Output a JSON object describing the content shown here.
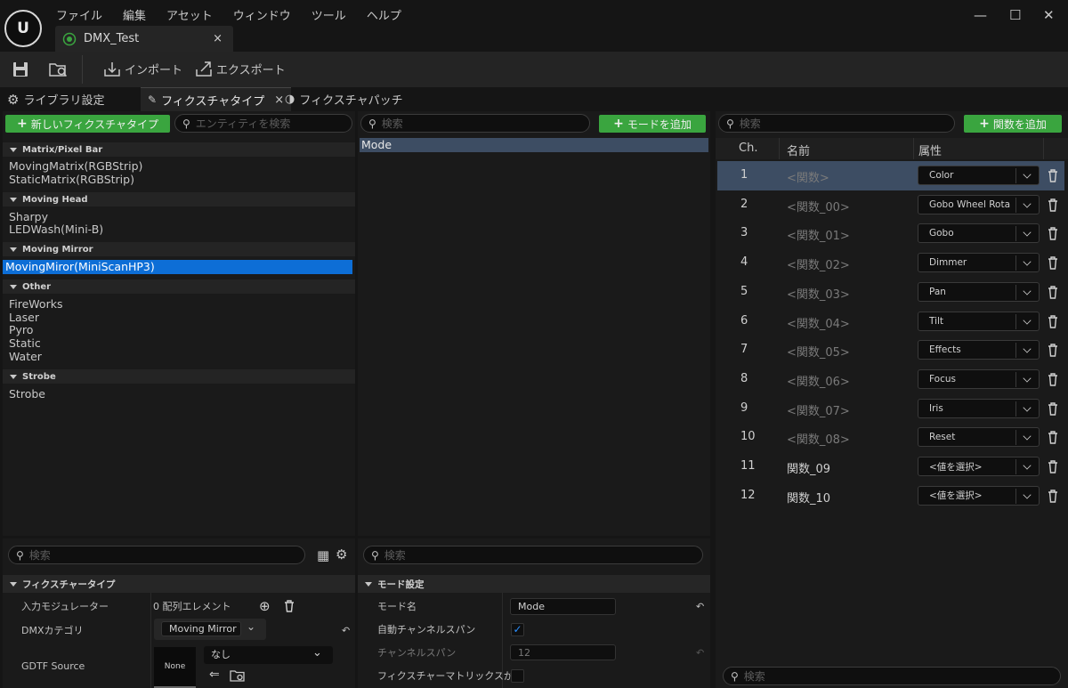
{
  "menu": [
    "ファイル",
    "編集",
    "アセット",
    "ウィンドウ",
    "ツール",
    "ヘルプ"
  ],
  "doc_tab": {
    "title": "DMX_Test",
    "close": "×"
  },
  "window_controls": {
    "minimize": "—",
    "maximize": "☐",
    "close": "✕"
  },
  "toolbar": {
    "import": "インポート",
    "export": "エクスポート"
  },
  "tabs": [
    {
      "label": "ライブラリ設定",
      "icon": "gear-icon"
    },
    {
      "label": "フィクスチャタイプ",
      "icon": "fixture-icon",
      "close": "×"
    },
    {
      "label": "フィクスチャパッチ",
      "icon": "patch-icon"
    }
  ],
  "left": {
    "new_button": "新しいフィクスチャタイプ",
    "search_placeholder": "エンティティを検索",
    "categories": [
      {
        "name": "Matrix/Pixel Bar",
        "items": [
          "MovingMatrix(RGBStrip)",
          "StaticMatrix(RGBStrip)"
        ]
      },
      {
        "name": "Moving Head",
        "items": [
          "Sharpy",
          "LEDWash(Mini-B)"
        ]
      },
      {
        "name": "Moving Mirror",
        "items": [
          "MovingMiror(MiniScanHP3)"
        ]
      },
      {
        "name": "Other",
        "items": [
          "FireWorks",
          "Laser",
          "Pyro",
          "Static",
          "Water"
        ]
      },
      {
        "name": "Strobe",
        "items": [
          "Strobe"
        ]
      }
    ],
    "selected_item": "MovingMiror(MiniScanHP3)"
  },
  "middle": {
    "search_placeholder": "検索",
    "add_mode_button": "モードを追加",
    "modes": [
      "Mode"
    ]
  },
  "right": {
    "search_placeholder": "検索",
    "add_function_button": "関数を追加",
    "headers": {
      "ch": "Ch.",
      "name": "名前",
      "attr": "属性"
    },
    "rows": [
      {
        "ch": "1",
        "name": "<関数>",
        "attr": "Color"
      },
      {
        "ch": "2",
        "name": "<関数_00>",
        "attr": "Gobo Wheel Rota"
      },
      {
        "ch": "3",
        "name": "<関数_01>",
        "attr": "Gobo"
      },
      {
        "ch": "4",
        "name": "<関数_02>",
        "attr": "Dimmer"
      },
      {
        "ch": "5",
        "name": "<関数_03>",
        "attr": "Pan"
      },
      {
        "ch": "6",
        "name": "<関数_04>",
        "attr": "Tilt"
      },
      {
        "ch": "7",
        "name": "<関数_05>",
        "attr": "Effects"
      },
      {
        "ch": "8",
        "name": "<関数_06>",
        "attr": "Focus"
      },
      {
        "ch": "9",
        "name": "<関数_07>",
        "attr": "Iris"
      },
      {
        "ch": "10",
        "name": "<関数_08>",
        "attr": "Reset"
      },
      {
        "ch": "11",
        "name": "関数_09",
        "attr": "<値を選択>"
      },
      {
        "ch": "12",
        "name": "関数_10",
        "attr": "<値を選択>"
      }
    ],
    "bottom_search_placeholder": "検索"
  },
  "details_left": {
    "search_placeholder": "検索",
    "section": "フィクスチャータイプ",
    "input_modulators_label": "入力モジュレーター",
    "input_modulators_value": "0 配列エレメント",
    "dmx_category_label": "DMXカテゴリ",
    "dmx_category_value": "Moving Mirror",
    "gdtf_source_label": "GDTF Source",
    "gdtf_thumb": "None",
    "gdtf_value": "なし"
  },
  "details_mid": {
    "search_placeholder": "検索",
    "section": "モード設定",
    "mode_name_label": "モード名",
    "mode_name_value": "Mode",
    "auto_span_label": "自動チャンネルスパン",
    "channel_span_label": "チャンネルスパン",
    "channel_span_value": "12",
    "matrix_label": "フィクスチャーマトリックスが..."
  },
  "colors": {
    "accent_green": "#3aa53f",
    "selection_blue": "#0d6ed6",
    "row_highlight": "#3d4d63"
  }
}
